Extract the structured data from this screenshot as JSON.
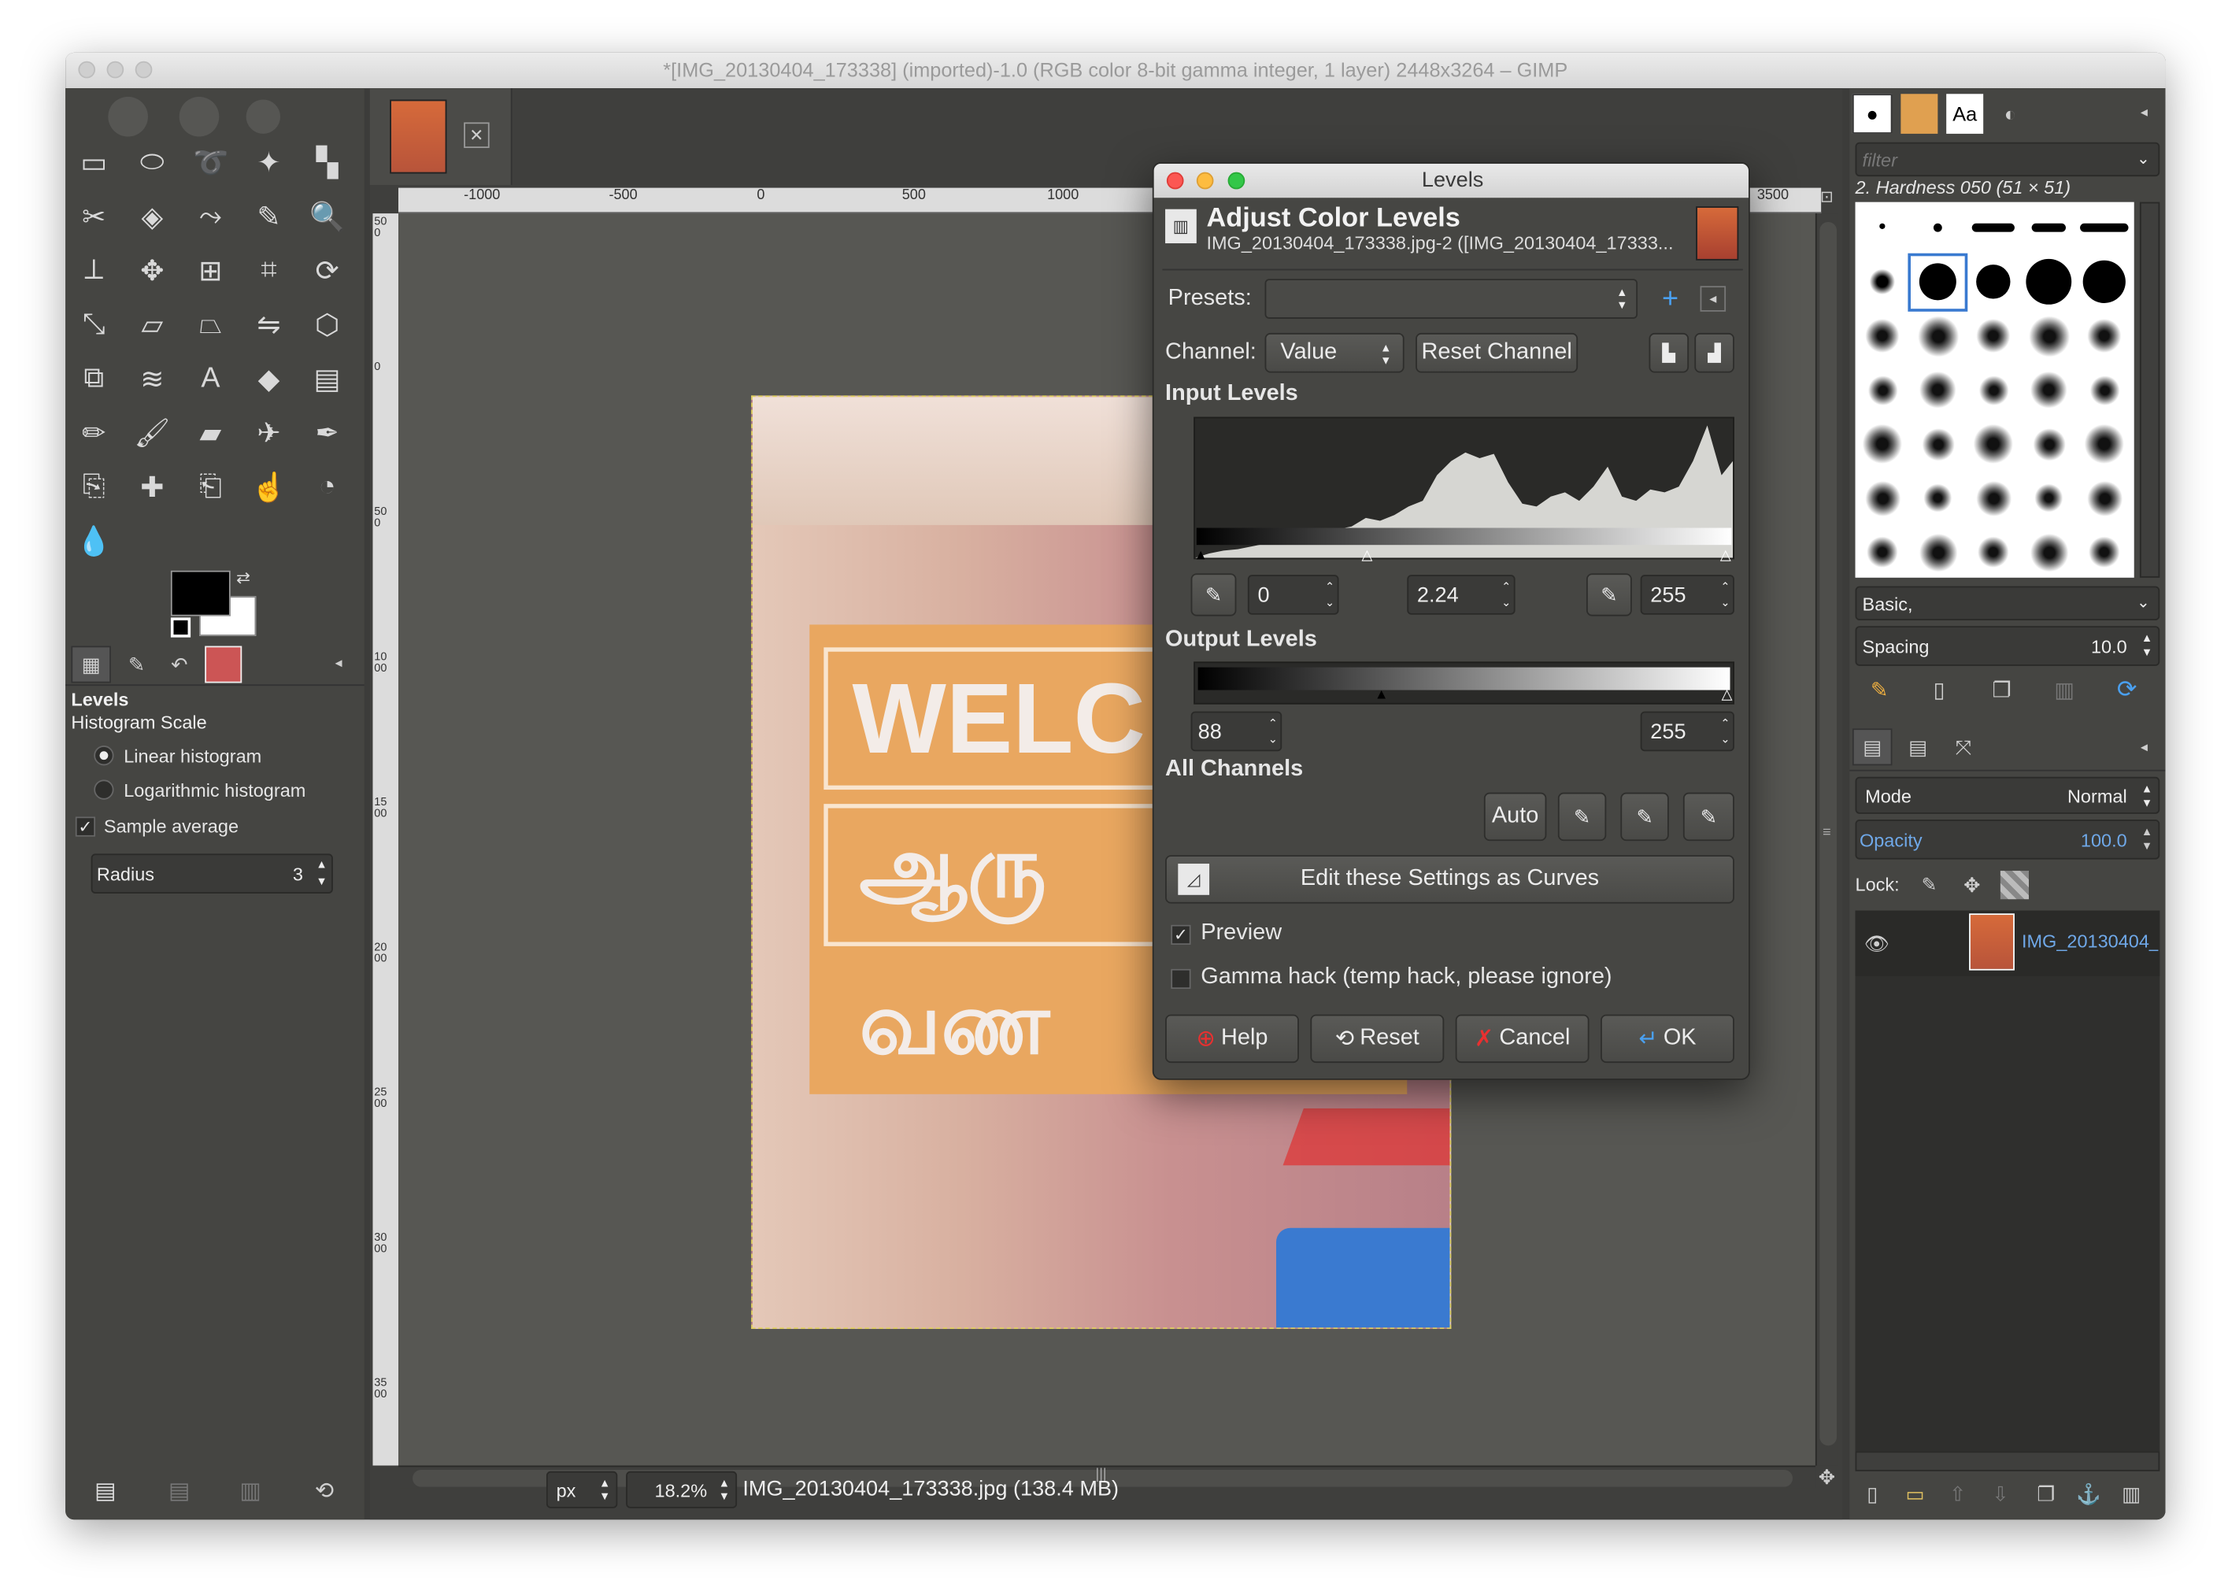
{
  "window": {
    "title": "*[IMG_20130404_173338] (imported)-1.0 (RGB color 8-bit gamma integer, 1 layer) 2448x3264 – GIMP"
  },
  "toolbox": {
    "icons": [
      "rect-select",
      "ellipse-select",
      "free-select",
      "fuzzy-select",
      "select-by-color",
      "scissors",
      "foreground-select",
      "paths",
      "color-picker",
      "zoom",
      "measure",
      "move",
      "align",
      "crop",
      "rotate",
      "scale",
      "shear",
      "perspective",
      "flip",
      "cage",
      "unified-transform",
      "warp",
      "text",
      "bucket-fill",
      "blend",
      "pencil",
      "paintbrush",
      "eraser",
      "airbrush",
      "ink",
      "clone",
      "heal",
      "perspective-clone",
      "smudge",
      "dodge-burn",
      "blur"
    ],
    "tabs": [
      "tool-options",
      "device-status",
      "undo-history",
      "images"
    ],
    "options_title": "Levels",
    "histogram_scale_label": "Histogram Scale",
    "linear_label": "Linear histogram",
    "log_label": "Logarithmic histogram",
    "sample_average_label": "Sample average",
    "radius_label": "Radius",
    "radius_value": "3",
    "histogram_mode": "linear"
  },
  "canvas": {
    "ruler_labels": [
      "-1000",
      "-500",
      "0",
      "500",
      "1000",
      "3500"
    ],
    "vruler_labels": [
      "500",
      "0",
      "500",
      "1000",
      "1500",
      "2000",
      "2500",
      "3000",
      "3500"
    ],
    "image_text": [
      "WELC",
      "ஆரு",
      "வண"
    ],
    "unit": "px",
    "zoom": "18.2%",
    "status": "IMG_20130404_173338.jpg (138.4 MB)"
  },
  "levels": {
    "dialog_title": "Levels",
    "heading": "Adjust Color Levels",
    "subheading": "IMG_20130404_173338.jpg-2 ([IMG_20130404_17333...",
    "presets_label": "Presets:",
    "presets_value": "",
    "channel_label": "Channel:",
    "channel_value": "Value",
    "reset_channel_label": "Reset Channel",
    "input_levels_label": "Input Levels",
    "input_low": "0",
    "input_gamma": "2.24",
    "input_high": "255",
    "output_levels_label": "Output Levels",
    "output_low": "88",
    "output_high": "255",
    "all_channels_label": "All Channels",
    "auto_label": "Auto",
    "edit_curves_label": "Edit these Settings as Curves",
    "preview_label": "Preview",
    "gamma_hack_label": "Gamma hack (temp hack, please ignore)",
    "help_label": "Help",
    "reset_label": "Reset",
    "cancel_label": "Cancel",
    "ok_label": "OK",
    "preview_checked": true,
    "gamma_hack_checked": false
  },
  "brushes": {
    "tabs": [
      "brushes",
      "patterns",
      "fonts",
      "document-history"
    ],
    "filter_placeholder": "filter",
    "selected_brush": "2. Hardness 050 (51 × 51)",
    "preset": "Basic,",
    "spacing_label": "Spacing",
    "spacing_value": "10.0"
  },
  "layers": {
    "tabs": [
      "layers",
      "channels",
      "paths"
    ],
    "mode_label": "Mode",
    "mode_value": "Normal",
    "opacity_label": "Opacity",
    "opacity_value": "100.0",
    "lock_label": "Lock:",
    "layer_name": "IMG_20130404_"
  }
}
